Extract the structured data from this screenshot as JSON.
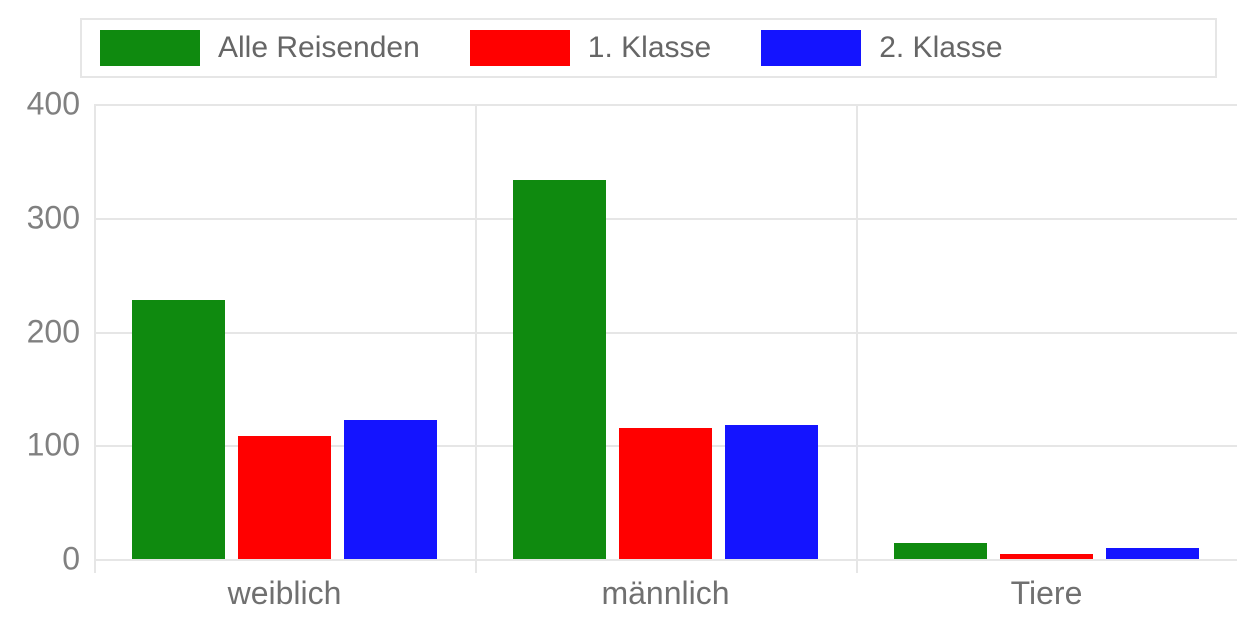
{
  "chart_data": {
    "type": "bar",
    "categories": [
      "weiblich",
      "männlich",
      "Tiere"
    ],
    "series": [
      {
        "name": "Alle Reisenden",
        "color": "#0f8a0f",
        "values": [
          228,
          333,
          14
        ]
      },
      {
        "name": "1. Klasse",
        "color": "#ff0000",
        "values": [
          108,
          115,
          4
        ]
      },
      {
        "name": "2. Klasse",
        "color": "#1414ff",
        "values": [
          122,
          118,
          10
        ]
      }
    ],
    "title": "",
    "xlabel": "",
    "ylabel": "",
    "ylim": [
      0,
      400
    ],
    "y_ticks": [
      0,
      100,
      200,
      300,
      400
    ]
  }
}
